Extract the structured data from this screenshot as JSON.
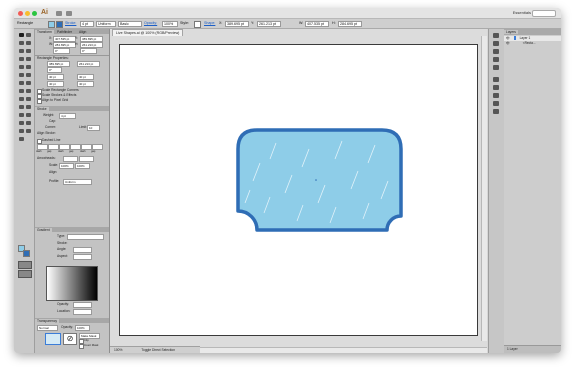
{
  "app": {
    "name": "Ai",
    "workspace": "Essentials",
    "document_tab": "Live Shapes.ai @ 100% (RGB/Preview)",
    "status_zoom": "100%",
    "status_tool": "Toggle Direct Selection"
  },
  "control_bar": {
    "selection_label": "Rectangle",
    "stroke_label": "Stroke:",
    "stroke_weight": "4 pt",
    "profile": "Uniform",
    "brush": "Basic",
    "opacity_label": "Opacity:",
    "opacity_value": "100%",
    "style_label": "Style:",
    "shape_link": "Shape:",
    "x_label": "X:",
    "x_value": "389.695 pt",
    "y_label": "Y:",
    "y_value": "261.213 pt",
    "w_label": "W:",
    "w_value": "407.535 pt",
    "h_label": "H:",
    "h_value": "284.695 pt"
  },
  "transform_panel": {
    "tabs": [
      "Transform",
      "Pathfinder",
      "Align"
    ],
    "x_label": "X:",
    "x_value": "407.535 pt",
    "y_label": "Y:",
    "y_value": "389.695 pt",
    "w_label": "W:",
    "w_value": "284.695 pt",
    "h_label": "H:",
    "h_value": "261.213 pt",
    "angle_value": "0°",
    "shear_value": "0°",
    "rect_props_label": "Rectangle Properties:",
    "rect_w": "389.695 pt",
    "rect_h": "261.213 pt",
    "rect_angle": "0°",
    "corner_tl": "40 pt",
    "corner_tr": "40 pt",
    "corner_bl": "40 pt",
    "corner_br": "40 pt",
    "scale_corners": "Scale Rectangle Corners",
    "scale_strokes": "Scale Strokes & Effects",
    "align_pixel": "Align to Pixel Grid"
  },
  "stroke_panel": {
    "tab": "Stroke",
    "weight_label": "Weight:",
    "weight_value": "4 pt",
    "cap_label": "Cap:",
    "corner_label": "Corner:",
    "limit_label": "Limit:",
    "limit_value": "10",
    "align_label": "Align Stroke:",
    "dashed_label": "Dashed Line",
    "dash_labels": [
      "dash",
      "gap",
      "dash",
      "gap",
      "dash",
      "gap"
    ],
    "arrowheads_label": "Arrowheads:",
    "scale_label": "Scale:",
    "scale_a": "100%",
    "scale_b": "100%",
    "align_label2": "Align:",
    "profile_label": "Profile:",
    "profile_value": "Uniform"
  },
  "gradient_panel": {
    "tab": "Gradient",
    "type_label": "Type:",
    "stroke_label": "Stroke:",
    "angle_label": "Angle:",
    "aspect_label": "Aspect:",
    "opacity_label": "Opacity:",
    "location_label": "Location:"
  },
  "transparency_panel": {
    "tab": "Transparency",
    "mode": "Normal",
    "opacity_label": "Opacity:",
    "opacity_value": "100%",
    "make_mask": "Make Mask",
    "clip": "Clip",
    "invert": "Invert Mask"
  },
  "layers_panel": {
    "tab": "Layers",
    "layer_name": "Layer 1",
    "sublayer_name": "<Recta...",
    "footer": "1 Layer",
    "visible_glyph": "👁"
  },
  "colors": {
    "shape_fill": "#8ecde8",
    "shape_stroke": "#2f6db5",
    "selection_blue": "#3b7dd8"
  },
  "icons": {
    "traffic_lights": [
      "close",
      "minimize",
      "zoom"
    ],
    "tools": [
      "selection-tool",
      "direct-selection-tool",
      "magic-wand-tool",
      "lasso-tool",
      "pen-tool",
      "type-tool",
      "line-tool",
      "rectangle-tool",
      "paintbrush-tool",
      "pencil-tool",
      "eraser-tool",
      "rotate-tool",
      "scale-tool",
      "width-tool",
      "free-transform-tool",
      "shape-builder-tool",
      "perspective-tool",
      "mesh-tool",
      "gradient-tool",
      "eyedropper-tool",
      "blend-tool",
      "symbol-sprayer-tool",
      "column-graph-tool",
      "artboard-tool",
      "slice-tool",
      "hand-tool",
      "zoom-tool"
    ]
  }
}
